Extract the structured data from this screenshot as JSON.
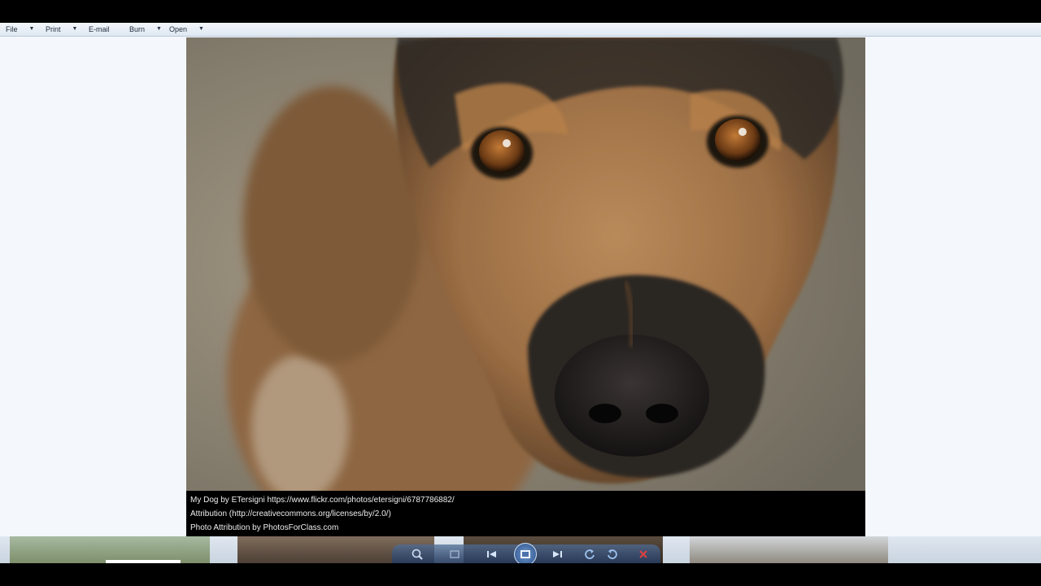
{
  "menu": {
    "file": "File",
    "print": "Print",
    "email": "E-mail",
    "burn": "Burn",
    "open": "Open"
  },
  "caption": {
    "line1": "My Dog by ETersigni https://www.flickr.com/photos/etersigni/6787786882/",
    "line2": "Attribution (http://creativecommons.org/licenses/by/2.0/)",
    "line3": "Photo Attribution by PhotosForClass.com"
  },
  "controls": {
    "icons": [
      "zoom-icon",
      "actual-size-icon",
      "previous-icon",
      "slideshow-icon",
      "next-icon",
      "rotate-counterclockwise-icon",
      "rotate-clockwise-icon",
      "delete-icon"
    ]
  },
  "colors": {
    "menubar": "#e6eef6",
    "viewer_background": "#f4f8fc",
    "caption_background": "#000000",
    "delete_icon": "#e04040"
  }
}
